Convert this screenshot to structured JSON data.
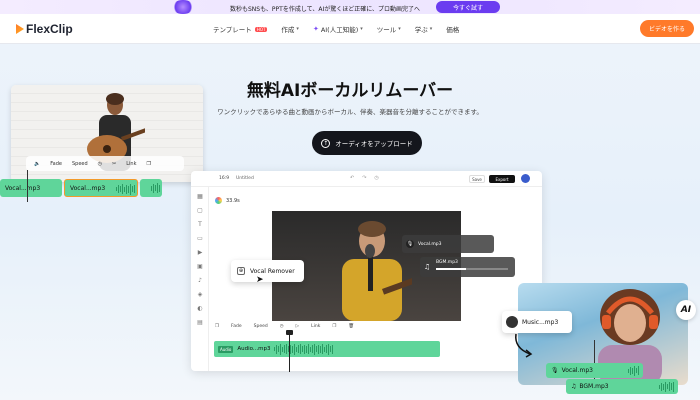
{
  "promo": {
    "text": "数秒もSNSも、PPTを作成して、AIが驚くほど正確に、プロ動画完了へ",
    "button": "今すぐ試す"
  },
  "nav": {
    "logo": "FlexClip",
    "items": [
      {
        "label": "テンプレート",
        "badge": "HOT"
      },
      {
        "label": "作成"
      },
      {
        "label": "AI(人工知能)"
      },
      {
        "label": "ツール"
      },
      {
        "label": "学ぶ"
      },
      {
        "label": "価格"
      }
    ],
    "cta": "ビデオを作る"
  },
  "hero": {
    "title": "無料AIボーカルリムーバー",
    "subtitle": "ワンクリックであらゆる曲と動画からボーカル、伴奏、楽器音を分離することができます。",
    "upload_button": "オーディオをアップロード"
  },
  "left_card": {
    "controls": [
      "Fade",
      "Speed",
      "Link"
    ],
    "clips": [
      "Vocal...mp3",
      "Vocal...mp3"
    ]
  },
  "editor": {
    "ratio": "16:9",
    "project": "Untitled",
    "save": "Save",
    "export": "Export",
    "duration": "33.9s",
    "vocal_label": "Vocal.mp3",
    "bgm_label": "BGM.mp3",
    "popup": "Vocal Remover",
    "tools": [
      "Fade",
      "Speed",
      "Link"
    ],
    "track_tag": "Audio",
    "track_label": "Audio...mp3"
  },
  "right_card": {
    "music_label": "Music...mp3",
    "ai_badge": "AI",
    "vocal_track": "Vocal.mp3",
    "bgm_track": "BGM.mp3"
  },
  "colors": {
    "accent": "#ff7a2a",
    "track": "#5fd59a",
    "dark": "#14161c"
  }
}
